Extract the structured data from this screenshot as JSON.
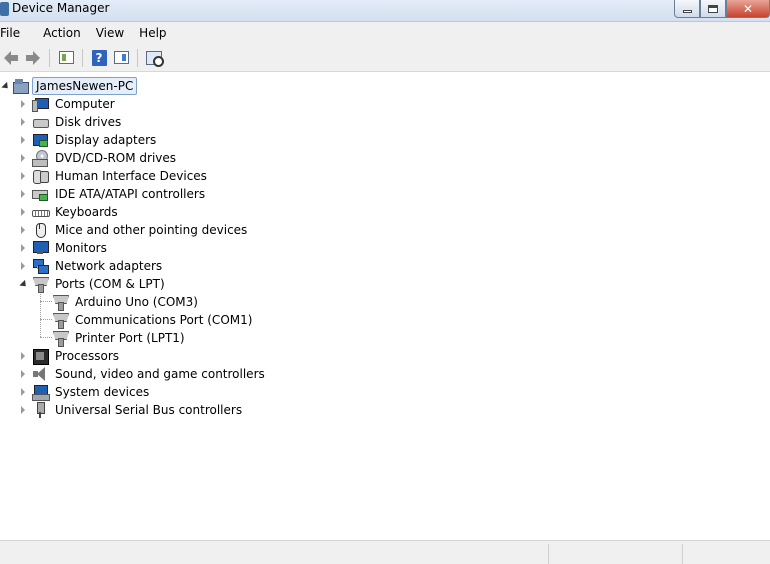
{
  "window": {
    "title": "Device Manager",
    "controls": {
      "minimize": "minimize",
      "maximize": "maximize",
      "close": "close"
    }
  },
  "menu": {
    "items": [
      "File",
      "Action",
      "View",
      "Help"
    ]
  },
  "toolbar": {
    "buttons": [
      "back-icon",
      "forward-icon",
      "properties-icon",
      "help-icon",
      "update-driver-icon",
      "scan-hardware-icon"
    ]
  },
  "tree": {
    "root": "JamesNewen-PC",
    "categories": [
      {
        "label": "Computer",
        "icon": "computer-icon",
        "expanded": false
      },
      {
        "label": "Disk drives",
        "icon": "disk-drive-icon",
        "expanded": false
      },
      {
        "label": "Display adapters",
        "icon": "display-adapter-icon",
        "expanded": false
      },
      {
        "label": "DVD/CD-ROM drives",
        "icon": "dvd-drive-icon",
        "expanded": false
      },
      {
        "label": "Human Interface Devices",
        "icon": "hid-icon",
        "expanded": false
      },
      {
        "label": "IDE ATA/ATAPI controllers",
        "icon": "ide-controller-icon",
        "expanded": false
      },
      {
        "label": "Keyboards",
        "icon": "keyboard-icon",
        "expanded": false
      },
      {
        "label": "Mice and other pointing devices",
        "icon": "mouse-icon",
        "expanded": false
      },
      {
        "label": "Monitors",
        "icon": "monitor-icon",
        "expanded": false
      },
      {
        "label": "Network adapters",
        "icon": "network-adapter-icon",
        "expanded": false
      },
      {
        "label": "Ports (COM & LPT)",
        "icon": "port-icon",
        "expanded": true,
        "children": [
          "Arduino Uno (COM3)",
          "Communications Port (COM1)",
          "Printer Port (LPT1)"
        ]
      },
      {
        "label": "Processors",
        "icon": "processor-icon",
        "expanded": false
      },
      {
        "label": "Sound, video and game controllers",
        "icon": "sound-icon",
        "expanded": false
      },
      {
        "label": "System devices",
        "icon": "system-device-icon",
        "expanded": false
      },
      {
        "label": "Universal Serial Bus controllers",
        "icon": "usb-icon",
        "expanded": false
      }
    ]
  },
  "colors": {
    "titlebar": "#d3e0ef",
    "close_button": "#c7422c",
    "selection_border": "#7da2ce",
    "chrome_background": "#f0f0f0"
  }
}
